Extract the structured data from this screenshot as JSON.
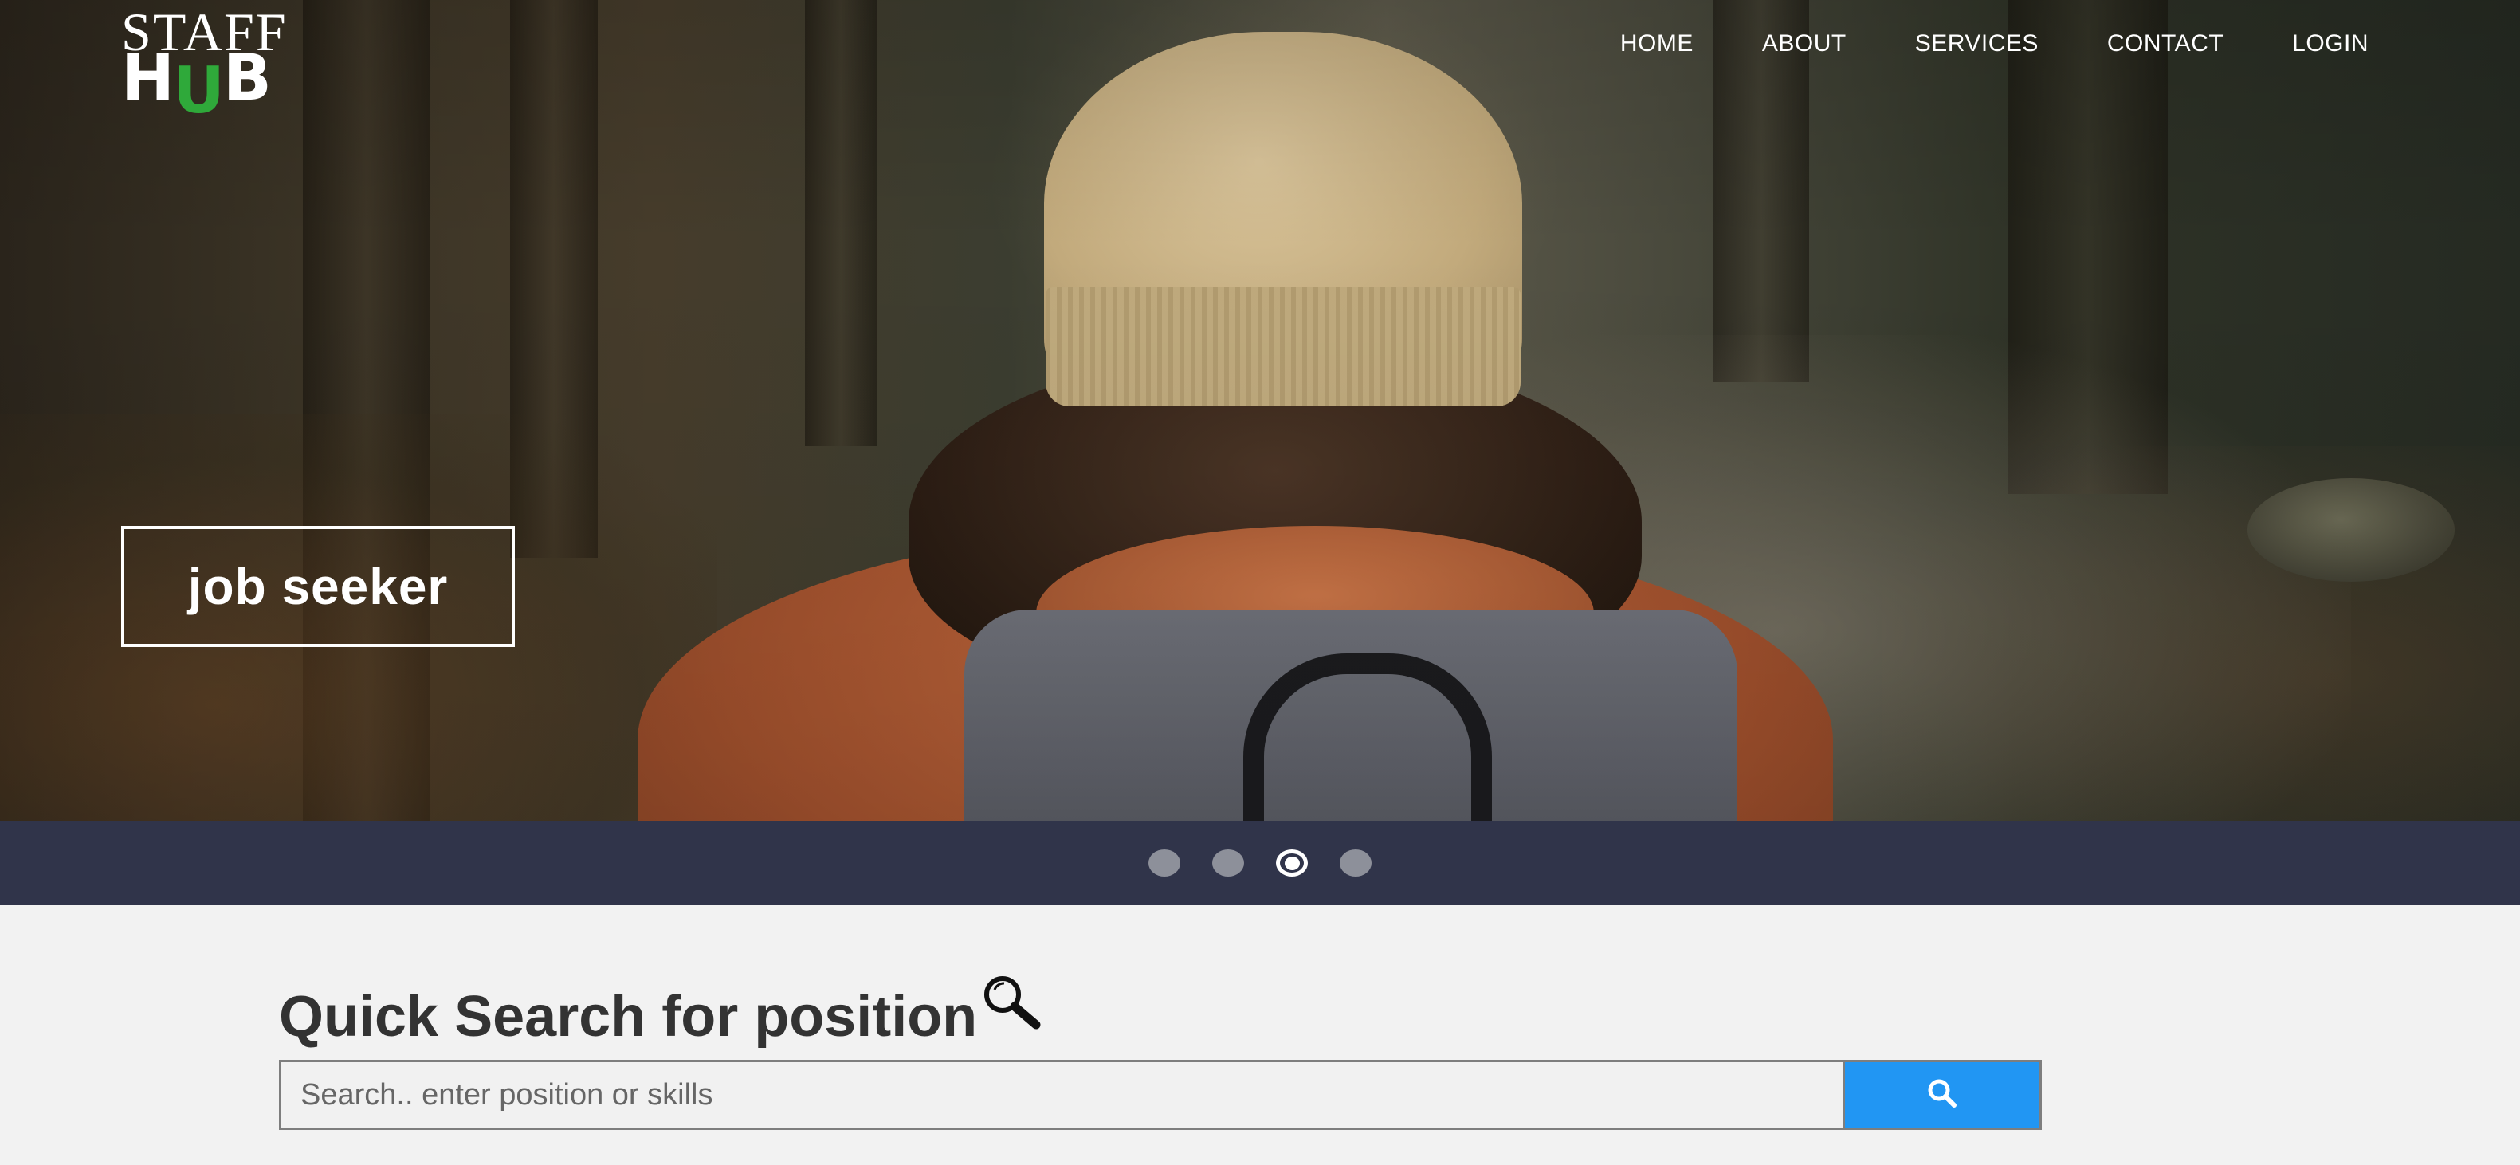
{
  "logo": {
    "top_text": "STAFF",
    "bottom_text_1": "H",
    "bottom_text_accent": "U",
    "bottom_text_2": "B",
    "accent_color": "#2fa93a"
  },
  "nav": {
    "items": [
      "HOME",
      "ABOUT",
      "SERVICES",
      "CONTACT",
      "LOGIN"
    ]
  },
  "hero": {
    "caption": "job seeker"
  },
  "carousel": {
    "slide_count": 4,
    "active_index": 2,
    "bar_color": "#30344a"
  },
  "search": {
    "title": "Quick Search for position",
    "title_icon": "magnifier-icon",
    "placeholder": "Search.. enter position or skills",
    "value": "",
    "button_icon": "search-icon",
    "button_color": "#2196f3"
  }
}
